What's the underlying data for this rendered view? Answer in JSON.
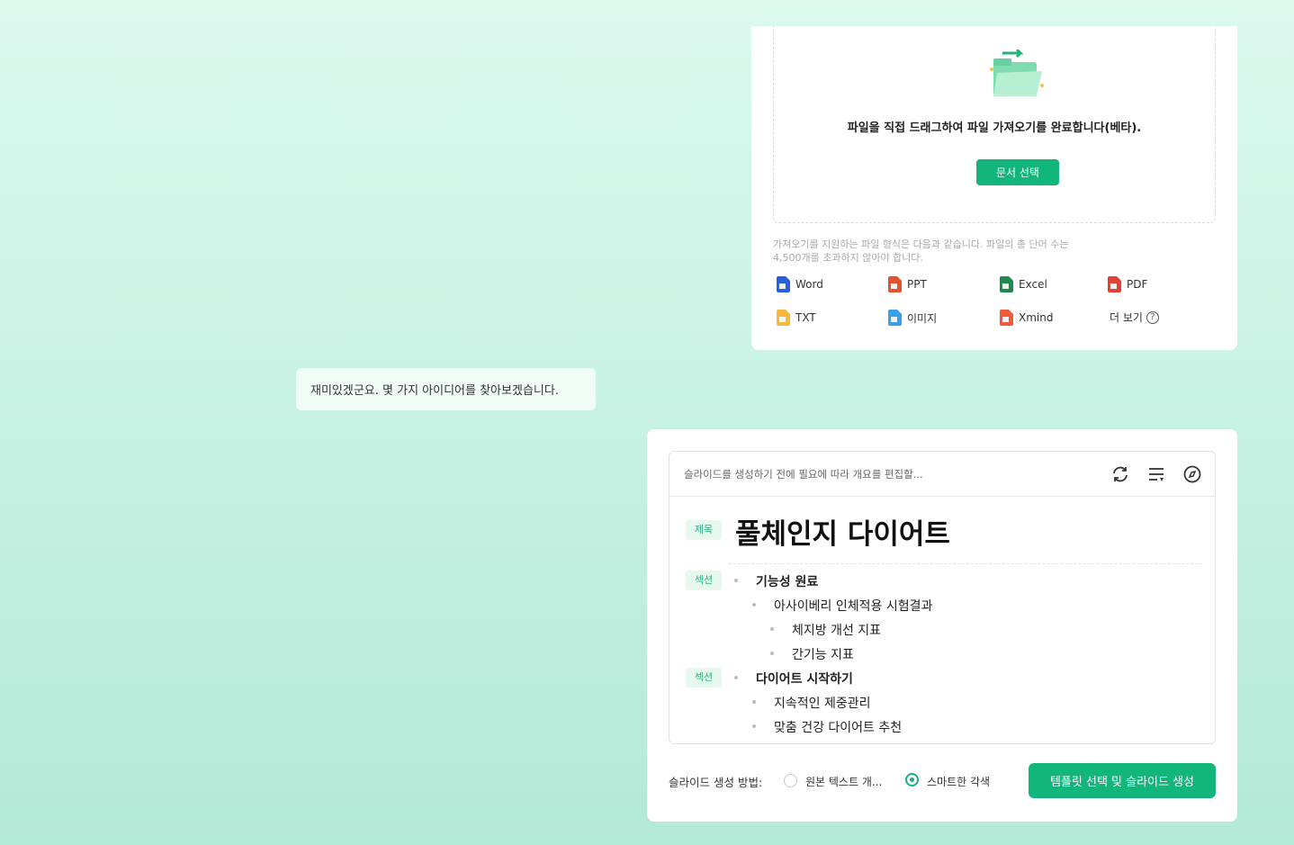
{
  "upload": {
    "drop_text": "파일을 직접 드래그하여 파일 가져오기를 완료합니다(베타).",
    "select_button": "문서 선택",
    "support_line1": "가져오기를 지원하는 파일 형식은 다음과 같습니다. 파일의 총 단어 수는",
    "support_line2": "4,500개를 초과하지 않아야 합니다.",
    "formats": [
      {
        "label": "Word",
        "icon": "word-icon",
        "color": "#2b5fd9"
      },
      {
        "label": "PPT",
        "icon": "ppt-icon",
        "color": "#e2522e"
      },
      {
        "label": "Excel",
        "icon": "excel-icon",
        "color": "#1f8a4c"
      },
      {
        "label": "PDF",
        "icon": "pdf-icon",
        "color": "#e0423a"
      },
      {
        "label": "TXT",
        "icon": "txt-icon",
        "color": "#f5b83d"
      },
      {
        "label": "이미지",
        "icon": "image-icon",
        "color": "#3aa0e6"
      },
      {
        "label": "Xmind",
        "icon": "xmind-icon",
        "color": "#ef5b3a"
      }
    ],
    "more_label": "더 보기"
  },
  "chat": {
    "bubble_text": "재미있겠군요. 몇 가지 아이디어를 찾아보겠습니다."
  },
  "outline": {
    "hint": "슬라이드를 생성하기 전에 필요에 따라 개요를 편집할...",
    "title_tag": "제목",
    "section_tag": "섹션",
    "title": "풀체인지 다이어트",
    "items": [
      "기능성 원료",
      "아사이베리 인체적용 시험결과",
      "체지방 개선 지표",
      "간기능 지표",
      "다이어트 시작하기",
      "지속적인 제중관리",
      "맞춤 건강 다이어트 추천"
    ]
  },
  "footer": {
    "method_label": "슬라이드 생성 방법:",
    "option_original": "원본 텍스트 개...",
    "option_smart": "스마트한 각색",
    "generate_button": "템플릿 선택 및 슬라이드 생성"
  },
  "colors": {
    "accent": "#12b57a",
    "tag_bg": "#e7f8ef",
    "tag_text": "#2fb07f"
  }
}
